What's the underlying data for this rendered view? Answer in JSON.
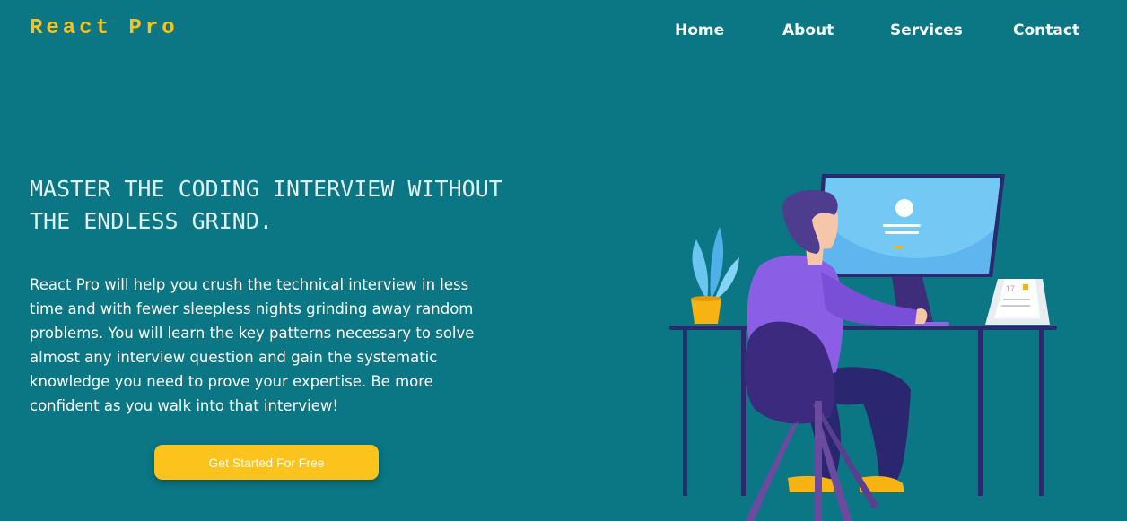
{
  "header": {
    "brand": "React Pro",
    "nav": {
      "home": "Home",
      "about": "About",
      "services": "Services",
      "contact": "Contact"
    }
  },
  "hero": {
    "headline": "MASTER THE CODING INTERVIEW WITHOUT THE ENDLESS GRIND.",
    "description": "React Pro will help you crush the technical interview in less time and with fewer sleepless nights grinding away random problems. You will learn the key patterns necessary to solve almost any interview question and gain the systematic knowledge you need to prove your expertise. Be more confident as you walk into that interview!",
    "cta_label": "Get Started For Free",
    "calendar_number": "17"
  },
  "colors": {
    "background": "#0b7684",
    "brand": "#f6c21c",
    "cta": "#fcc31c"
  },
  "icons": [
    "developer-at-desk-illustration"
  ]
}
